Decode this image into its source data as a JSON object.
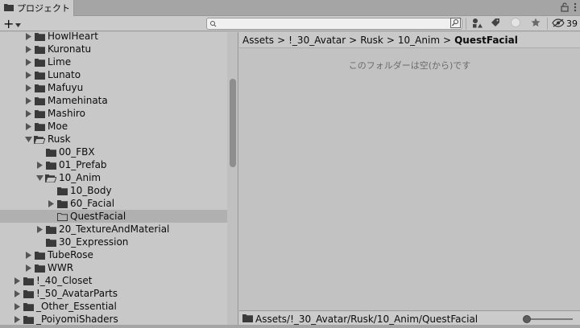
{
  "tab": {
    "title": "プロジェクト",
    "icon": "folder-icon"
  },
  "tabbar_icons": [
    "lock-icon",
    "more-vert-icon"
  ],
  "toolbar": {
    "create_label": "+",
    "search": {
      "value": "",
      "placeholder": ""
    },
    "hidden_count": "39"
  },
  "tree": {
    "selected": "QuestFacial",
    "rows": [
      {
        "label": "HowlHeart",
        "depth": 2,
        "arrow": "right",
        "folder": "closed"
      },
      {
        "label": "Kuronatu",
        "depth": 2,
        "arrow": "right",
        "folder": "closed"
      },
      {
        "label": "Lime",
        "depth": 2,
        "arrow": "right",
        "folder": "closed"
      },
      {
        "label": "Lunato",
        "depth": 2,
        "arrow": "right",
        "folder": "closed"
      },
      {
        "label": "Mafuyu",
        "depth": 2,
        "arrow": "right",
        "folder": "closed"
      },
      {
        "label": "Mamehinata",
        "depth": 2,
        "arrow": "right",
        "folder": "closed"
      },
      {
        "label": "Mashiro",
        "depth": 2,
        "arrow": "right",
        "folder": "closed"
      },
      {
        "label": "Moe",
        "depth": 2,
        "arrow": "right",
        "folder": "closed"
      },
      {
        "label": "Rusk",
        "depth": 2,
        "arrow": "down",
        "folder": "open"
      },
      {
        "label": "00_FBX",
        "depth": 3,
        "arrow": "none",
        "folder": "closed"
      },
      {
        "label": "01_Prefab",
        "depth": 3,
        "arrow": "right",
        "folder": "closed"
      },
      {
        "label": "10_Anim",
        "depth": 3,
        "arrow": "down",
        "folder": "open"
      },
      {
        "label": "10_Body",
        "depth": 4,
        "arrow": "none",
        "folder": "closed"
      },
      {
        "label": "60_Facial",
        "depth": 4,
        "arrow": "right",
        "folder": "closed"
      },
      {
        "label": "QuestFacial",
        "depth": 4,
        "arrow": "none",
        "folder": "empty"
      },
      {
        "label": "20_TextureAndMaterial",
        "depth": 3,
        "arrow": "right",
        "folder": "closed"
      },
      {
        "label": "30_Expression",
        "depth": 3,
        "arrow": "none",
        "folder": "closed"
      },
      {
        "label": "TubeRose",
        "depth": 2,
        "arrow": "right",
        "folder": "closed"
      },
      {
        "label": "WWR",
        "depth": 2,
        "arrow": "right",
        "folder": "closed"
      },
      {
        "label": "!_40_Closet",
        "depth": 1,
        "arrow": "right",
        "folder": "closed"
      },
      {
        "label": "!_50_AvatarParts",
        "depth": 1,
        "arrow": "right",
        "folder": "closed"
      },
      {
        "label": "_Other_Essential",
        "depth": 1,
        "arrow": "right",
        "folder": "closed"
      },
      {
        "label": "_PoiyomiShaders",
        "depth": 1,
        "arrow": "right",
        "folder": "closed"
      }
    ]
  },
  "breadcrumb": [
    "Assets",
    "!_30_Avatar",
    "Rusk",
    "10_Anim",
    "QuestFacial"
  ],
  "breadcrumb_separator": ">",
  "empty_message": "このフォルダーは空(から)です",
  "status_path": "Assets/!_30_Avatar/Rusk/10_Anim/QuestFacial",
  "zoom_slider": {
    "value": 0.0
  }
}
